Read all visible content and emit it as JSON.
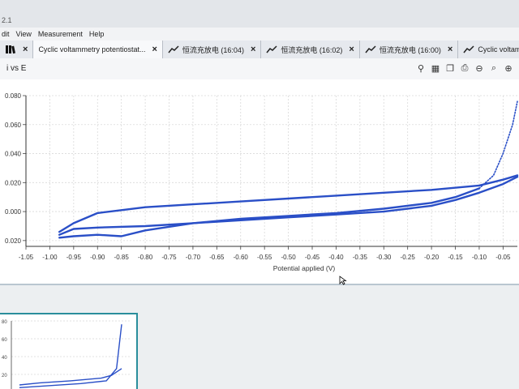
{
  "window": {
    "title": "2.1"
  },
  "menu": [
    "dit",
    "View",
    "Measurement",
    "Help"
  ],
  "tabs": [
    {
      "label": "",
      "icon": "books-icon",
      "active": false
    },
    {
      "label": "Cyclic voltammetry potentiostat...",
      "icon": "",
      "active": true
    },
    {
      "label": "恒流充放电 (16:04)",
      "icon": "chart-icon",
      "active": false
    },
    {
      "label": "恒流充放电 (16:02)",
      "icon": "chart-icon",
      "active": false
    },
    {
      "label": "恒流充放电 (16:00)",
      "icon": "chart-icon",
      "active": false
    },
    {
      "label": "Cyclic voltammetry pote",
      "icon": "chart-icon",
      "active": false
    }
  ],
  "toolbar": {
    "plot_title": "i vs E",
    "tools": [
      "microscope-icon",
      "table-icon",
      "copy-icon",
      "print-icon",
      "zoom-out-icon",
      "zoom-icon",
      "zoom-in-icon"
    ]
  },
  "chart_data": {
    "type": "line",
    "title": "",
    "xlabel": "Potential applied (V)",
    "ylabel": "",
    "xlim": [
      -1.05,
      -0.02
    ],
    "ylim": [
      -0.024,
      0.08
    ],
    "x_ticks": [
      -1.05,
      -1.0,
      -0.95,
      -0.9,
      -0.85,
      -0.8,
      -0.75,
      -0.7,
      -0.65,
      -0.6,
      -0.55,
      -0.5,
      -0.45,
      -0.4,
      -0.35,
      -0.3,
      -0.25,
      -0.2,
      -0.15,
      -0.1,
      -0.05
    ],
    "x_tick_labels": [
      "-1.05",
      "-1.00",
      "-0.95",
      "-0.90",
      "-0.85",
      "-0.80",
      "-0.75",
      "-0.70",
      "-0.65",
      "-0.60",
      "-0.55",
      "-0.50",
      "-0.45",
      "-0.40",
      "-0.35",
      "-0.30",
      "-0.25",
      "-0.20",
      "-0.15",
      "-0.10",
      "-0.05"
    ],
    "y_ticks": [
      0.08,
      0.06,
      0.04,
      0.02,
      0.0,
      -0.02
    ],
    "y_tick_labels": [
      "0.080",
      "0.060",
      "0.040",
      "0.020",
      "0.000",
      "0.020"
    ],
    "grid": true,
    "series": [
      {
        "color": "#2a4fc7",
        "style": "solid",
        "x": [
          -0.98,
          -0.95,
          -0.9,
          -0.8,
          -0.7,
          -0.6,
          -0.5,
          -0.4,
          -0.3,
          -0.2,
          -0.15,
          -0.1,
          -0.05,
          -0.02
        ],
        "y": [
          -0.016,
          -0.012,
          -0.011,
          -0.01,
          -0.008,
          -0.006,
          -0.004,
          -0.002,
          0.0,
          0.004,
          0.008,
          0.013,
          0.019,
          0.024
        ]
      },
      {
        "color": "#2a4fc7",
        "style": "solid",
        "x": [
          -0.02,
          -0.05,
          -0.1,
          -0.2,
          -0.3,
          -0.4,
          -0.5,
          -0.6,
          -0.7,
          -0.8,
          -0.85,
          -0.9,
          -0.95,
          -0.98
        ],
        "y": [
          0.025,
          0.022,
          0.018,
          0.015,
          0.013,
          0.011,
          0.009,
          0.007,
          0.005,
          0.003,
          0.001,
          -0.001,
          -0.008,
          -0.014
        ]
      },
      {
        "color": "#2a4fc7",
        "style": "solid",
        "x": [
          -0.98,
          -0.95,
          -0.9,
          -0.85,
          -0.8,
          -0.7,
          -0.6,
          -0.5,
          -0.4,
          -0.3,
          -0.2,
          -0.15,
          -0.1
        ],
        "y": [
          -0.018,
          -0.017,
          -0.016,
          -0.017,
          -0.013,
          -0.008,
          -0.005,
          -0.003,
          -0.001,
          0.002,
          0.006,
          0.01,
          0.016
        ]
      },
      {
        "color": "#2a4fc7",
        "style": "dotted",
        "x": [
          -0.1,
          -0.07,
          -0.05,
          -0.03,
          -0.02
        ],
        "y": [
          0.016,
          0.025,
          0.04,
          0.06,
          0.076
        ]
      }
    ]
  },
  "thumbnail": {
    "y_tick_labels": [
      "80",
      "60",
      "40",
      "20"
    ],
    "series": [
      {
        "color": "#2a4fc7",
        "x": [
          0.0,
          0.2,
          0.5,
          0.8,
          0.9,
          1.0
        ],
        "y": [
          0.06,
          0.09,
          0.12,
          0.16,
          0.2,
          0.3
        ]
      },
      {
        "color": "#2a4fc7",
        "x": [
          0.0,
          0.3,
          0.6,
          0.85,
          0.95,
          1.0
        ],
        "y": [
          0.02,
          0.05,
          0.08,
          0.12,
          0.3,
          0.95
        ]
      }
    ]
  }
}
